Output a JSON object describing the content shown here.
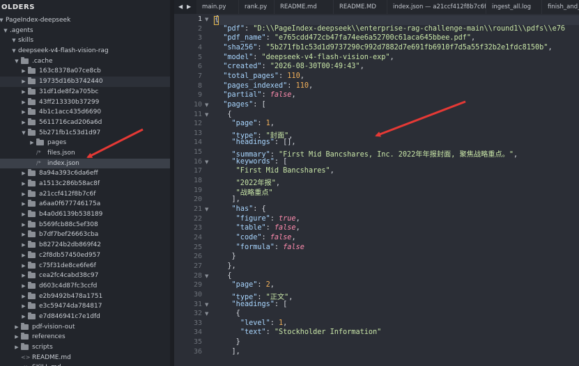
{
  "sidebar": {
    "header": "OLDERS",
    "items": [
      {
        "label": "PageIndex-deepseek",
        "indent": 0,
        "kind": "folder-open"
      },
      {
        "label": ".agents",
        "indent": 1,
        "kind": "folder-open"
      },
      {
        "label": "skills",
        "indent": 2,
        "kind": "folder-open"
      },
      {
        "label": "deepseek-v4-flash-vision-rag",
        "indent": 3,
        "kind": "folder-open"
      },
      {
        "label": ".cache",
        "indent": 4,
        "kind": "folder-open"
      },
      {
        "label": "163c8378a07ce8cb",
        "indent": 5,
        "kind": "folder"
      },
      {
        "label": "19735d16b3742440",
        "indent": 5,
        "kind": "folder"
      },
      {
        "label": "31df1de8f2a705bc",
        "indent": 5,
        "kind": "folder"
      },
      {
        "label": "43ff213330b37299",
        "indent": 5,
        "kind": "folder"
      },
      {
        "label": "4b1c1acc435d6690",
        "indent": 5,
        "kind": "folder"
      },
      {
        "label": "5611716cad206a6d",
        "indent": 5,
        "kind": "folder"
      },
      {
        "label": "5b271fb1c53d1d97",
        "indent": 5,
        "kind": "folder-open"
      },
      {
        "label": "pages",
        "indent": 6,
        "kind": "folder"
      },
      {
        "label": "files.json",
        "indent": 6,
        "kind": "file"
      },
      {
        "label": "index.json",
        "indent": 6,
        "kind": "file"
      },
      {
        "label": "8a94a393c6da6eff",
        "indent": 5,
        "kind": "folder"
      },
      {
        "label": "a1513c286b58ac8f",
        "indent": 5,
        "kind": "folder"
      },
      {
        "label": "a21ccf412f8b7c6f",
        "indent": 5,
        "kind": "folder"
      },
      {
        "label": "a6aa0f677746175a",
        "indent": 5,
        "kind": "folder"
      },
      {
        "label": "b4a0d6139b538189",
        "indent": 5,
        "kind": "folder"
      },
      {
        "label": "b569fcb88c5ef308",
        "indent": 5,
        "kind": "folder"
      },
      {
        "label": "b7df7bef26663cba",
        "indent": 5,
        "kind": "folder"
      },
      {
        "label": "b82724b2db869f42",
        "indent": 5,
        "kind": "folder"
      },
      {
        "label": "c2f8db57450ed957",
        "indent": 5,
        "kind": "folder"
      },
      {
        "label": "c75f31de8ce6fe6f",
        "indent": 5,
        "kind": "folder"
      },
      {
        "label": "cea2fc4cabd38c97",
        "indent": 5,
        "kind": "folder"
      },
      {
        "label": "d603c4d87fc3ccfd",
        "indent": 5,
        "kind": "folder"
      },
      {
        "label": "e2b9492b478a1751",
        "indent": 5,
        "kind": "folder"
      },
      {
        "label": "e3c59474da784817",
        "indent": 5,
        "kind": "folder"
      },
      {
        "label": "e7d846941c7e1dfd",
        "indent": 5,
        "kind": "folder"
      },
      {
        "label": "pdf-vision-out",
        "indent": 4,
        "kind": "folder"
      },
      {
        "label": "references",
        "indent": 4,
        "kind": "folder"
      },
      {
        "label": "scripts",
        "indent": 4,
        "kind": "folder"
      },
      {
        "label": "README.md",
        "indent": 4,
        "kind": "md"
      },
      {
        "label": "SKILL.md",
        "indent": 4,
        "kind": "md"
      }
    ],
    "selected_index": 14,
    "hover_index": 6
  },
  "tabs": [
    {
      "label": "main.py"
    },
    {
      "label": "rank.py"
    },
    {
      "label": "README.md"
    },
    {
      "label": "README.MD"
    },
    {
      "label": "index.json — a21ccf412f8b7c6f"
    },
    {
      "label": "ingest_all.log"
    },
    {
      "label": "finish_and_sc"
    }
  ],
  "editor": {
    "current_line": 1,
    "lines": [
      [
        [
          "p",
          "{"
        ]
      ],
      [
        [
          "p",
          "  "
        ],
        [
          "k",
          "\"pdf\""
        ],
        [
          "p",
          ": "
        ],
        [
          "s",
          "\"D:\\\\PageIndex-deepseek\\\\enterprise-rag-challenge-main\\\\round1\\\\pdfs\\\\e76"
        ]
      ],
      [
        [
          "p",
          "  "
        ],
        [
          "k",
          "\"pdf_name\""
        ],
        [
          "p",
          ": "
        ],
        [
          "s",
          "\"e765cdd472cb47fa74ee6a52700c61aca645bbee.pdf\""
        ],
        [
          "p",
          ","
        ]
      ],
      [
        [
          "p",
          "  "
        ],
        [
          "k",
          "\"sha256\""
        ],
        [
          "p",
          ": "
        ],
        [
          "s",
          "\"5b271fb1c53d1d9737290c992d7882d7e691fb6910f7d5a55f32b2e1fdc8150b\""
        ],
        [
          "p",
          ","
        ]
      ],
      [
        [
          "p",
          "  "
        ],
        [
          "k",
          "\"model\""
        ],
        [
          "p",
          ": "
        ],
        [
          "s",
          "\"deepseek-v4-flash-vision-exp\""
        ],
        [
          "p",
          ","
        ]
      ],
      [
        [
          "p",
          "  "
        ],
        [
          "k",
          "\"created\""
        ],
        [
          "p",
          ": "
        ],
        [
          "s",
          "\"2026-08-30T00:49:43\""
        ],
        [
          "p",
          ","
        ]
      ],
      [
        [
          "p",
          "  "
        ],
        [
          "k",
          "\"total_pages\""
        ],
        [
          "p",
          ": "
        ],
        [
          "n",
          "110"
        ],
        [
          "p",
          ","
        ]
      ],
      [
        [
          "p",
          "  "
        ],
        [
          "k",
          "\"pages_indexed\""
        ],
        [
          "p",
          ": "
        ],
        [
          "n",
          "110"
        ],
        [
          "p",
          ","
        ]
      ],
      [
        [
          "p",
          "  "
        ],
        [
          "k",
          "\"partial\""
        ],
        [
          "p",
          ": "
        ],
        [
          "b",
          "false"
        ],
        [
          "p",
          ","
        ]
      ],
      [
        [
          "p",
          "  "
        ],
        [
          "k",
          "\"pages\""
        ],
        [
          "p",
          ": ["
        ]
      ],
      [
        [
          "p",
          "   {"
        ]
      ],
      [
        [
          "p",
          "    "
        ],
        [
          "k",
          "\"page\""
        ],
        [
          "p",
          ": "
        ],
        [
          "n",
          "1"
        ],
        [
          "p",
          ","
        ]
      ],
      [
        [
          "p",
          "    "
        ],
        [
          "k",
          "\"type\""
        ],
        [
          "p",
          ": "
        ],
        [
          "s",
          "\"封面\""
        ],
        [
          "p",
          ","
        ]
      ],
      [
        [
          "p",
          "    "
        ],
        [
          "k",
          "\"headings\""
        ],
        [
          "p",
          ": [],"
        ]
      ],
      [
        [
          "p",
          "    "
        ],
        [
          "k",
          "\"summary\""
        ],
        [
          "p",
          ": "
        ],
        [
          "s",
          "\"First Mid Bancshares, Inc. 2022年年报封面, 聚焦战略重点。\""
        ],
        [
          "p",
          ","
        ]
      ],
      [
        [
          "p",
          "    "
        ],
        [
          "k",
          "\"keywords\""
        ],
        [
          "p",
          ": ["
        ]
      ],
      [
        [
          "p",
          "     "
        ],
        [
          "s",
          "\"First Mid Bancshares\""
        ],
        [
          "p",
          ","
        ]
      ],
      [
        [
          "p",
          "     "
        ],
        [
          "s",
          "\"2022年报\""
        ],
        [
          "p",
          ","
        ]
      ],
      [
        [
          "p",
          "     "
        ],
        [
          "s",
          "\"战略重点\""
        ]
      ],
      [
        [
          "p",
          "    ],"
        ]
      ],
      [
        [
          "p",
          "    "
        ],
        [
          "k",
          "\"has\""
        ],
        [
          "p",
          ": {"
        ]
      ],
      [
        [
          "p",
          "     "
        ],
        [
          "k",
          "\"figure\""
        ],
        [
          "p",
          ": "
        ],
        [
          "b",
          "true"
        ],
        [
          "p",
          ","
        ]
      ],
      [
        [
          "p",
          "     "
        ],
        [
          "k",
          "\"table\""
        ],
        [
          "p",
          ": "
        ],
        [
          "b",
          "false"
        ],
        [
          "p",
          ","
        ]
      ],
      [
        [
          "p",
          "     "
        ],
        [
          "k",
          "\"code\""
        ],
        [
          "p",
          ": "
        ],
        [
          "b",
          "false"
        ],
        [
          "p",
          ","
        ]
      ],
      [
        [
          "p",
          "     "
        ],
        [
          "k",
          "\"formula\""
        ],
        [
          "p",
          ": "
        ],
        [
          "b",
          "false"
        ]
      ],
      [
        [
          "p",
          "    }"
        ]
      ],
      [
        [
          "p",
          "   },"
        ]
      ],
      [
        [
          "p",
          "   {"
        ]
      ],
      [
        [
          "p",
          "    "
        ],
        [
          "k",
          "\"page\""
        ],
        [
          "p",
          ": "
        ],
        [
          "n",
          "2"
        ],
        [
          "p",
          ","
        ]
      ],
      [
        [
          "p",
          "    "
        ],
        [
          "k",
          "\"type\""
        ],
        [
          "p",
          ": "
        ],
        [
          "s",
          "\"正文\""
        ],
        [
          "p",
          ","
        ]
      ],
      [
        [
          "p",
          "    "
        ],
        [
          "k",
          "\"headings\""
        ],
        [
          "p",
          ": ["
        ]
      ],
      [
        [
          "p",
          "     {"
        ]
      ],
      [
        [
          "p",
          "      "
        ],
        [
          "k",
          "\"level\""
        ],
        [
          "p",
          ": "
        ],
        [
          "n",
          "1"
        ],
        [
          "p",
          ","
        ]
      ],
      [
        [
          "p",
          "      "
        ],
        [
          "k",
          "\"text\""
        ],
        [
          "p",
          ": "
        ],
        [
          "s",
          "\"Stockholder Information\""
        ]
      ],
      [
        [
          "p",
          "     }"
        ]
      ],
      [
        [
          "p",
          "    ],"
        ]
      ]
    ],
    "fold_lines": [
      1,
      10,
      11,
      16,
      21,
      28,
      31,
      32
    ]
  },
  "colors": {
    "sidebar_bg": "#22252b",
    "editor_bg": "#2b2e36",
    "key": "#a9d6ff",
    "string": "#c9e6a8",
    "number": "#f3b15a",
    "boolean": "#ff8cae",
    "annotation_arrow": "#e53935"
  },
  "icons": {
    "back": "arrow-left-icon",
    "forward": "arrow-right-icon",
    "folder": "folder-icon",
    "file": "file-json-icon",
    "markdown": "markdown-icon",
    "fold": "chevron-down-icon"
  }
}
